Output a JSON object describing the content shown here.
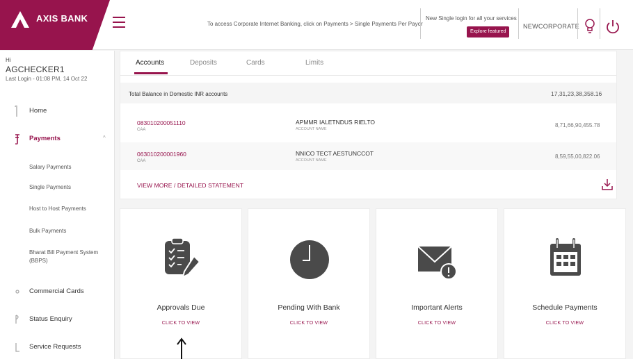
{
  "brand": {
    "name": "AXIS BANK",
    "color": "#97144d"
  },
  "header": {
    "notice": "To access Corporate Internet Banking, click on Payments > Single Payments Per Payor",
    "sso_text": "New Single login for all your services",
    "explore_label": "Explore featured",
    "username": "NEWCORPORATE",
    "icons": [
      "menu-icon",
      "bulb-icon",
      "power-icon"
    ]
  },
  "user": {
    "hello": "Hi",
    "name": "AGCHECKER1",
    "last_login": "Last Login - 01:08 PM, 14 Oct 22"
  },
  "sidebar": {
    "items": [
      {
        "label": "Home"
      },
      {
        "label": "Payments",
        "chevron": "^"
      },
      {
        "label": "Commercial Cards"
      },
      {
        "label": "Status Enquiry"
      },
      {
        "label": "Service Requests"
      }
    ],
    "payments_sub": [
      "Salary Payments",
      "Single Payments",
      "Host to Host Payments",
      "Bulk Payments",
      "Bharat Bill Payment System (BBPS)"
    ]
  },
  "accounts": {
    "tabs": [
      "Accounts",
      "Deposits",
      "Cards",
      "Limits"
    ],
    "active_tab": "Accounts",
    "total_label": "Total Balance in Domestic INR accounts",
    "total_amount": "17,31,23,38,358.16",
    "rows": [
      {
        "number": "083010200051110",
        "type": "CAA",
        "name": "APMMR IALETNDUS RIELTO",
        "name_label": "ACCOUNT NAME",
        "balance": "8,71,66,90,455.78"
      },
      {
        "number": "063010200001960",
        "type": "CAA",
        "name": "NNICO TECT AESTUNCCOT",
        "name_label": "ACCOUNT NAME",
        "balance": "8,59,55,00,822.06"
      }
    ],
    "view_more": "VIEW MORE / DETAILED STATEMENT"
  },
  "tiles": [
    {
      "title": "Approvals Due",
      "cta": "CLICK TO VIEW",
      "icon": "checklist-icon"
    },
    {
      "title": "Pending With Bank",
      "cta": "CLICK TO VIEW",
      "icon": "clock-icon"
    },
    {
      "title": "Important Alerts",
      "cta": "CLICK TO VIEW",
      "icon": "mail-alert-icon"
    },
    {
      "title": "Schedule Payments",
      "cta": "CLICK TO VIEW",
      "icon": "calendar-icon"
    }
  ]
}
